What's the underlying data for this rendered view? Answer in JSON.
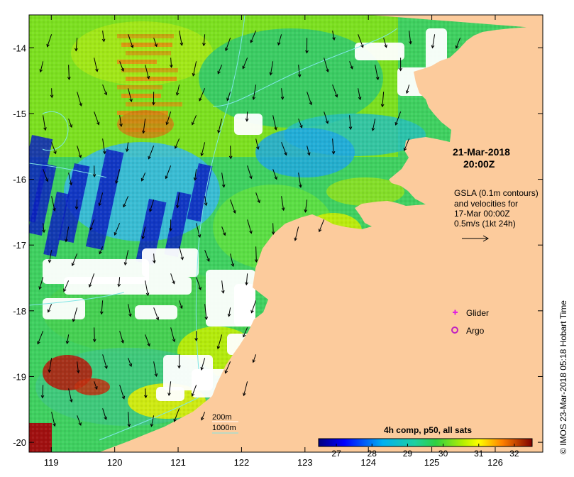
{
  "map": {
    "lon_range": [
      118.65,
      126.75
    ],
    "lat_range": [
      -20.15,
      -13.5
    ],
    "lon_ticks": [
      119,
      120,
      121,
      122,
      123,
      124,
      125,
      126
    ],
    "lat_ticks": [
      -14,
      -15,
      -16,
      -17,
      -18,
      -19,
      -20
    ],
    "lon_tick_labels": [
      "119",
      "120",
      "121",
      "122",
      "123",
      "124",
      "125",
      "126"
    ],
    "lat_tick_labels": [
      "-14",
      "-15",
      "-16",
      "-17",
      "-18",
      "-19",
      "-20"
    ]
  },
  "colors": {
    "land": "#fccb9c",
    "no_data": "#ffffff",
    "contour": "#7fe6e6",
    "glider": "#e01ee0",
    "argo": "#c020c0"
  },
  "timestamp": {
    "line1": "21-Mar-2018",
    "line2": "20:00Z"
  },
  "gsla_note": {
    "line1": "GSLA (0.1m contours)",
    "line2": "and velocities for",
    "line3": "17-Mar 00:00Z",
    "line4": "0.5m/s (1kt 24h)"
  },
  "legend": {
    "glider": "Glider",
    "argo": "Argo"
  },
  "isobaths": {
    "label_200": "200m",
    "label_1000": "1000m"
  },
  "colorbar": {
    "title": "4h comp, p50, all sats",
    "min": 26.5,
    "max": 32.5,
    "tick_values": [
      27,
      28,
      29,
      30,
      31,
      32
    ],
    "tick_labels": [
      "27",
      "28",
      "29",
      "30",
      "31",
      "32"
    ]
  },
  "credit": "© IMOS 23-Mar-2018 05:18 Hobart Time"
}
